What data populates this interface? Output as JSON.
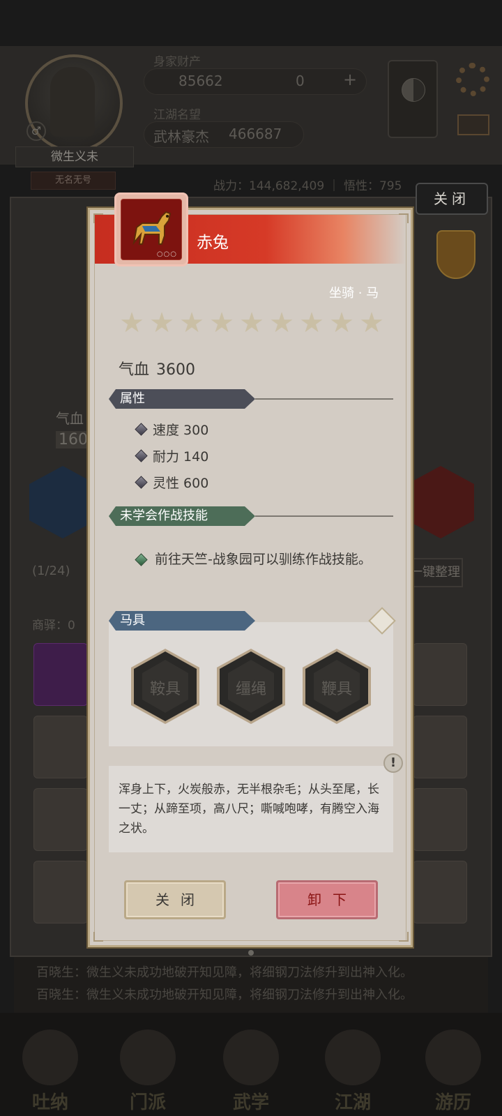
{
  "background": {
    "player": {
      "name": "微生义未",
      "title": "无名无号"
    },
    "wealth_label": "身家财产",
    "silver": "85662",
    "jade": "0",
    "fame_label": "江湖名望",
    "fame_rank": "武林豪杰",
    "fame_value": "466687",
    "stats_line": "战力：144,682,409 ｜ 悟性：795",
    "close_top_label": "关闭",
    "hp_label": "气血",
    "hp_value": "160",
    "bag_count": "(1/24)",
    "sort_label": "一键整理",
    "post_label": "商驿：0",
    "log": [
      "百晓生：微生义未成功地破开知见障，将细钢刀法修升到出神入化。",
      "百晓生：微生义未成功地破开知见障，将细钢刀法修升到出神入化。"
    ],
    "nav": [
      "吐纳",
      "门派",
      "武学",
      "江湖",
      "游历"
    ]
  },
  "dialog": {
    "item_name": "赤兔",
    "item_type": "坐骑 · 马",
    "icon_dots": "○○○",
    "stars": 9,
    "star_glyph": "★",
    "hp_label": "气血",
    "hp_value": "3600",
    "attr_section": "属性",
    "attributes": [
      {
        "text": "速度 300"
      },
      {
        "text": "耐力 140"
      },
      {
        "text": "灵性 600"
      }
    ],
    "skill_section": "未学会作战技能",
    "skill_text": "前往天竺-战象园可以驯练作战技能。",
    "gear_section": "马具",
    "gear_slots": [
      "鞍具",
      "缰绳",
      "鞭具"
    ],
    "info_glyph": "!",
    "description": "浑身上下，火炭般赤，无半根杂毛；从头至尾，长一丈；从蹄至项，高八尺；嘶喊咆哮，有腾空入海之状。",
    "close_label": "关闭",
    "unequip_label": "卸下"
  },
  "colors": {
    "name_bar": "#d63a27",
    "unequip": "#d8848a",
    "tab_dark": "#4c4e58",
    "tab_green": "#4d6d58",
    "tab_blue": "#4c6680"
  }
}
